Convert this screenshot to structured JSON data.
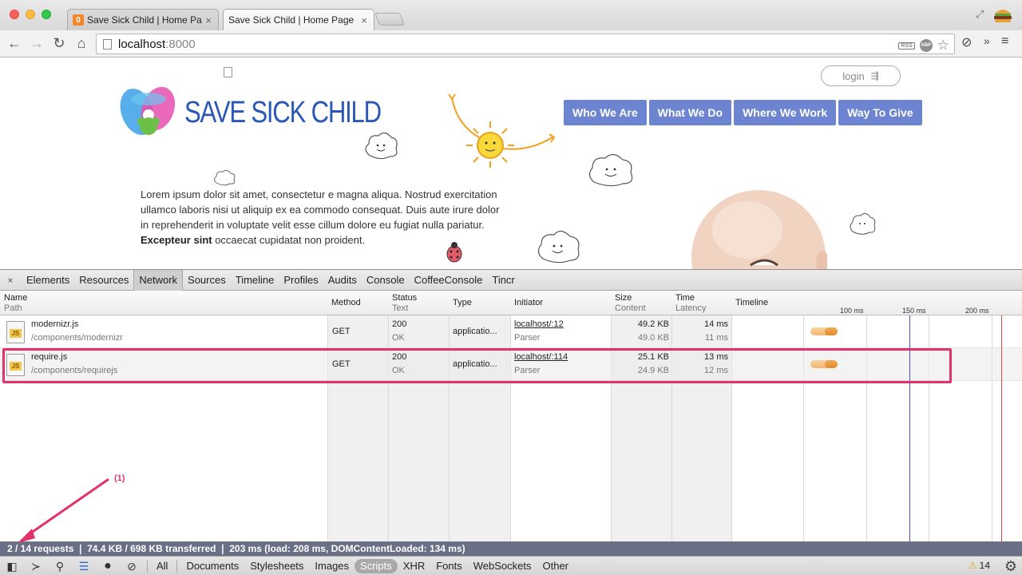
{
  "browser": {
    "tabs": [
      {
        "title": "Save Sick Child | Home Page",
        "favicon": "orange-page-icon",
        "active": false
      },
      {
        "title": "Save Sick Child | Home Page",
        "favicon": "page-icon",
        "active": true
      }
    ],
    "url_host": "localhost",
    "url_port": ":8000",
    "rss_badge": "RSS",
    "abp_badge": "ABP"
  },
  "page": {
    "logo_text": "SAVE SICK CHILD",
    "login_label": "login",
    "nav": [
      "Who We Are",
      "What We Do",
      "Where We Work",
      "Way To Give"
    ],
    "lorem_lines": [
      "Lorem ipsum dolor sit amet, consectetur e magna aliqua. Nostrud exercitation",
      "ullamco laboris nisi ut aliquip ex ea commodo consequat. Duis aute irure dolor",
      "in reprehenderit in voluptate velit esse cillum dolore eu fugiat nulla pariatur."
    ],
    "lorem_bold": "Excepteur sint",
    "lorem_tail": " occaecat cupidatat non proident."
  },
  "devtools": {
    "close_glyph": "×",
    "tabs": [
      "Elements",
      "Resources",
      "Network",
      "Sources",
      "Timeline",
      "Profiles",
      "Audits",
      "Console",
      "CoffeeConsole",
      "Tincr"
    ],
    "selected_tab": "Network",
    "columns": {
      "name": "Name",
      "path": "Path",
      "method": "Method",
      "status": "Status",
      "text": "Text",
      "type": "Type",
      "initiator": "Initiator",
      "size": "Size",
      "content": "Content",
      "time": "Time",
      "latency": "Latency",
      "timeline": "Timeline"
    },
    "ticks": [
      "100 ms",
      "150 ms",
      "200 ms"
    ],
    "rows": [
      {
        "name": "modernizr.js",
        "path": "/components/modernizr",
        "method": "GET",
        "status": "200",
        "status_text": "OK",
        "type": "applicatio...",
        "initiator": "localhost/:12",
        "initiator_sub": "Parser",
        "size": "49.2 KB",
        "content": "49.0 KB",
        "time": "14 ms",
        "latency": "11 ms",
        "icon_label": "JS"
      },
      {
        "name": "require.js",
        "path": "/components/requirejs",
        "method": "GET",
        "status": "200",
        "status_text": "OK",
        "type": "applicatio...",
        "initiator": "localhost/:114",
        "initiator_sub": "Parser",
        "size": "25.1 KB",
        "content": "24.9 KB",
        "time": "13 ms",
        "latency": "12 ms",
        "icon_label": "JS"
      }
    ],
    "summary": "2 / 14 requests  ❘  74.4 KB / 698 KB transferred  ❘  203 ms (load: 208 ms, DOMContentLoaded: 134 ms)",
    "filters": [
      "All",
      "Documents",
      "Stylesheets",
      "Images",
      "Scripts",
      "XHR",
      "Fonts",
      "WebSockets",
      "Other"
    ],
    "selected_filter": "Scripts",
    "warnings": "14",
    "annotation": "(1)"
  },
  "colors": {
    "nav_bg": "#6d84d0",
    "logo_blue": "#2b57b6",
    "annotation_pink": "#e0336b",
    "summary_bg": "#6a6f86"
  }
}
